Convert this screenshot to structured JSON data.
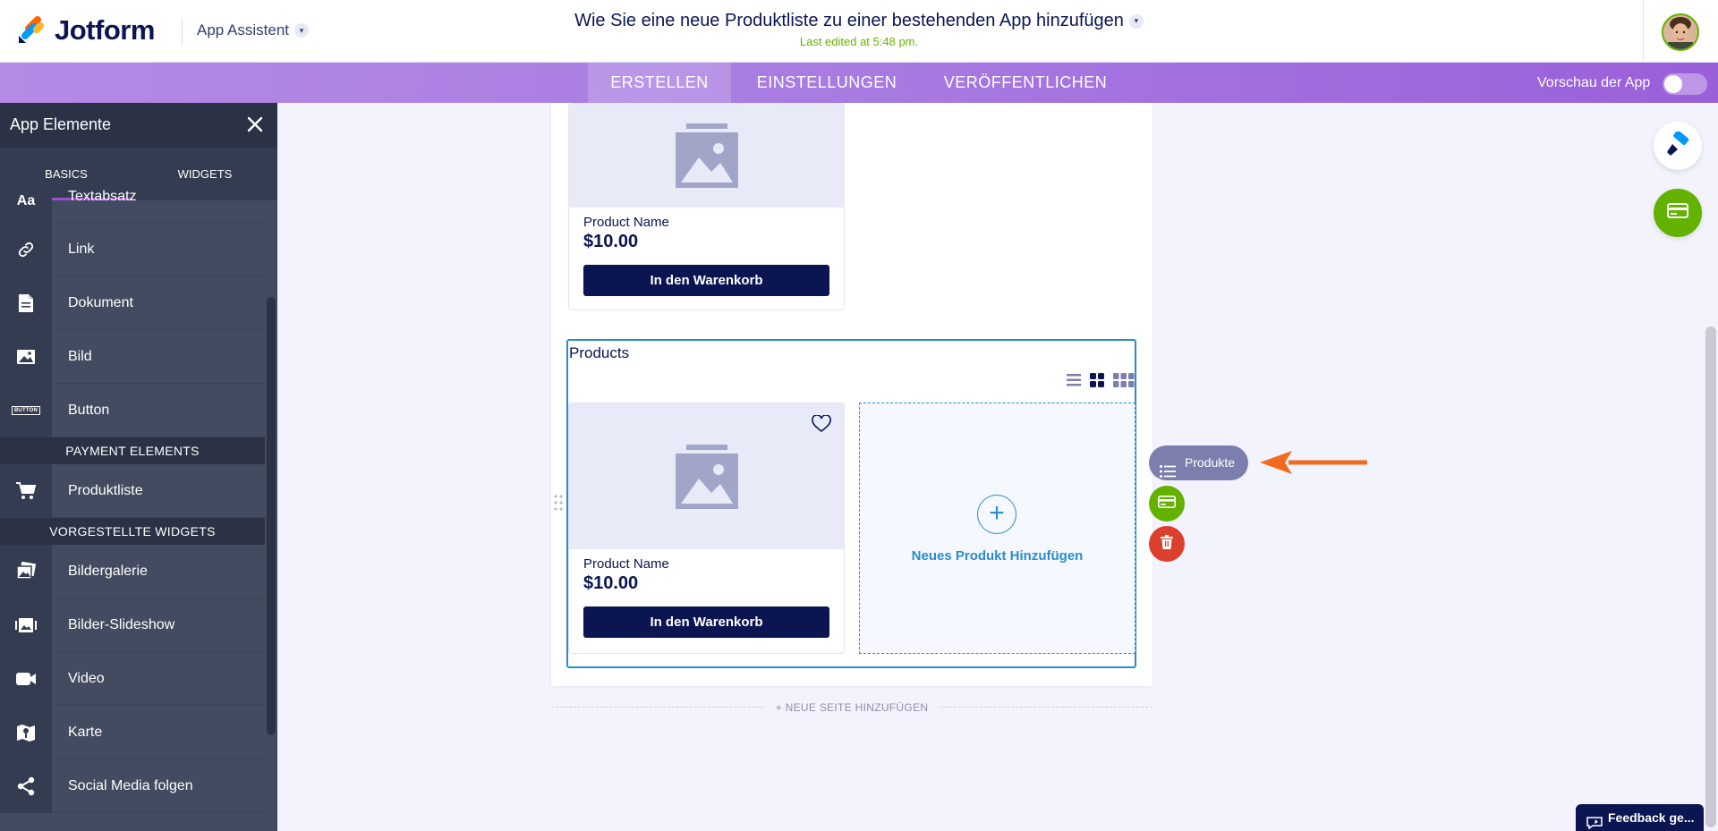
{
  "header": {
    "brand": "Jotform",
    "app_assistant": "App Assistent",
    "doc_title": "Wie Sie eine neue Produktliste zu einer bestehenden App hinzufügen",
    "last_edited": "Last edited at 5:48 pm."
  },
  "nav": {
    "tabs": [
      {
        "label": "ERSTELLEN",
        "active": true
      },
      {
        "label": "EINSTELLUNGEN",
        "active": false
      },
      {
        "label": "VERÖFFENTLICHEN",
        "active": false
      }
    ],
    "preview_label": "Vorschau der App",
    "preview_on": false
  },
  "sidebar": {
    "title": "App Elemente",
    "tabs": [
      {
        "label": "BASICS",
        "active": true
      },
      {
        "label": "WIDGETS",
        "active": false
      }
    ],
    "items_top": [
      {
        "label": "Textabsatz",
        "icon": "text-icon",
        "glyph": "Aa"
      },
      {
        "label": "Link",
        "icon": "link-icon"
      },
      {
        "label": "Dokument",
        "icon": "document-icon"
      },
      {
        "label": "Bild",
        "icon": "image-icon"
      },
      {
        "label": "Button",
        "icon": "button-icon",
        "glyph": "BUTTON"
      }
    ],
    "section_payment": "PAYMENT ELEMENTS",
    "items_payment": [
      {
        "label": "Produktliste",
        "icon": "cart-icon"
      }
    ],
    "section_widgets": "VORGESTELLTE WIDGETS",
    "items_widgets": [
      {
        "label": "Bildergalerie",
        "icon": "gallery-icon"
      },
      {
        "label": "Bilder-Slideshow",
        "icon": "slideshow-icon"
      },
      {
        "label": "Video",
        "icon": "video-icon"
      },
      {
        "label": "Karte",
        "icon": "map-icon"
      },
      {
        "label": "Social Media folgen",
        "icon": "share-icon"
      }
    ]
  },
  "canvas": {
    "top_product": {
      "name": "Product Name",
      "price": "$10.00",
      "button": "In den Warenkorb"
    },
    "products_block": {
      "title": "Products",
      "product": {
        "name": "Product Name",
        "price": "$10.00",
        "button": "In den Warenkorb"
      },
      "add_new": "Neues Produkt Hinzufügen"
    },
    "new_page": "+ NEUE SEITE HINZUFÜGEN"
  },
  "element_tools": {
    "pill_label": "Produkte"
  },
  "feedback": {
    "label": "Feedback ge..."
  },
  "colors": {
    "brand_navy": "#0a1551",
    "accent_blue": "#2b8ccf",
    "nav_purple": "#a77be1",
    "green": "#64b200",
    "red": "#dc3f2c",
    "arrow_orange": "#f26b1d"
  }
}
